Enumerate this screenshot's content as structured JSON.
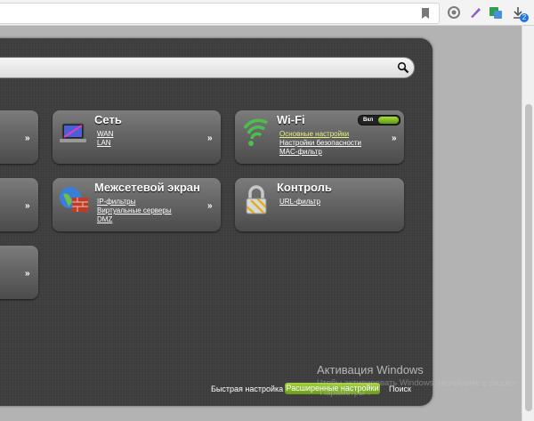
{
  "browser": {
    "downloads_badge": "2"
  },
  "search": {
    "value": "",
    "placeholder": ""
  },
  "tiles": {
    "left1": {
      "arrow": "»"
    },
    "left2": {
      "arrow": "»"
    },
    "left3": {
      "arrow": "»"
    },
    "network": {
      "title": "Сеть",
      "links": [
        "WAN",
        "LAN"
      ],
      "arrow": "»"
    },
    "wifi": {
      "title": "Wi-Fi",
      "toggle_label": "Вкл",
      "links": [
        "Основные настройки",
        "Настройки безопасности",
        "MAC-фильтр"
      ],
      "arrow": "»"
    },
    "firewall": {
      "title": "Межсетевой экран",
      "links": [
        "IP-фильтры",
        "Виртуальные серверы",
        "DMZ"
      ],
      "arrow": "»"
    },
    "control": {
      "title": "Контроль",
      "links": [
        "URL-фильтр"
      ]
    }
  },
  "bottom_nav": {
    "quick": "Быстрая настройка",
    "advanced": "Расширенные настройки",
    "search": "Поиск"
  },
  "watermark": {
    "line1": "Активация Windows",
    "line2": "Чтобы активировать Windows, перейдите в раздел \"Параметры\"."
  },
  "colors": {
    "accent_green": "#7fb52a",
    "panel": "#3d3d3d",
    "highlight_link": "#e9f27c"
  }
}
